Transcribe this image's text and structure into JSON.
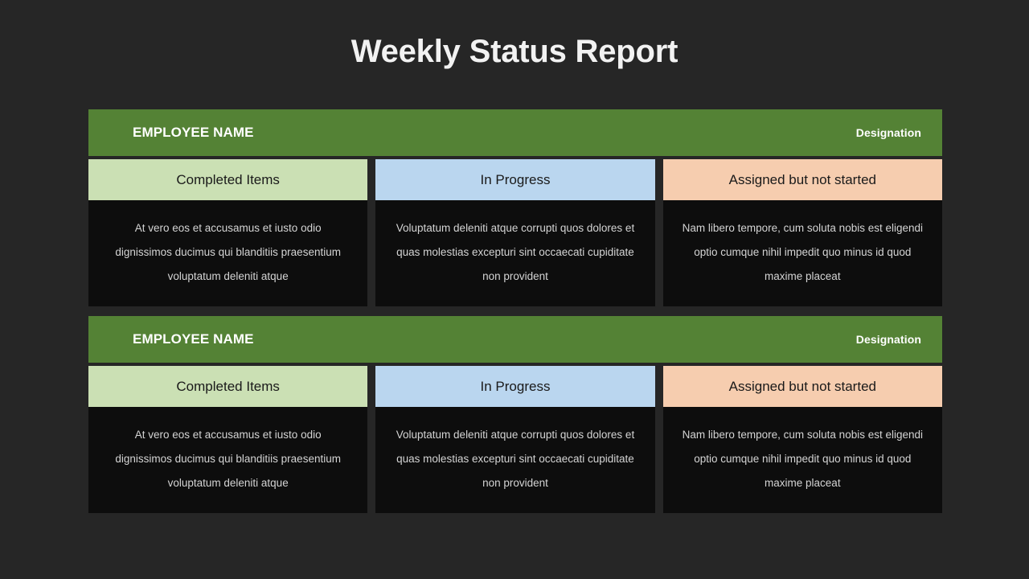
{
  "slide": {
    "title": "Weekly Status Report",
    "background_color": "#262626",
    "accent_color": "#548235"
  },
  "colors": {
    "header_green": "#548235",
    "completed_green": "#cbe0b4",
    "inprogress_blue": "#bad6ef",
    "assigned_peach": "#f6cdaf",
    "panel_dark": "#0d0d0d",
    "title_text": "#f2f2f2",
    "body_text": "#d4d4d4"
  },
  "blocks": [
    {
      "employee_name": "EMPLOYEE NAME",
      "designation": "Designation",
      "columns": [
        {
          "heading": "Completed Items",
          "body": "At vero eos et accusamus et iusto odio dignissimos ducimus qui blanditiis praesentium voluptatum deleniti atque"
        },
        {
          "heading": "In Progress",
          "body": "Voluptatum deleniti atque corrupti quos dolores et quas molestias excepturi sint occaecati cupiditate non provident"
        },
        {
          "heading": "Assigned but not started",
          "body": "Nam libero tempore, cum soluta nobis est eligendi optio cumque nihil impedit quo minus id quod maxime placeat"
        }
      ]
    },
    {
      "employee_name": "EMPLOYEE NAME",
      "designation": "Designation",
      "columns": [
        {
          "heading": "Completed Items",
          "body": "At vero eos et accusamus et iusto odio dignissimos ducimus qui blanditiis praesentium voluptatum deleniti atque"
        },
        {
          "heading": "In Progress",
          "body": "Voluptatum deleniti atque corrupti quos dolores et quas molestias excepturi sint occaecati cupiditate non provident"
        },
        {
          "heading": "Assigned but not started",
          "body": "Nam libero tempore, cum soluta nobis est eligendi optio cumque nihil impedit quo minus id quod maxime placeat"
        }
      ]
    }
  ]
}
